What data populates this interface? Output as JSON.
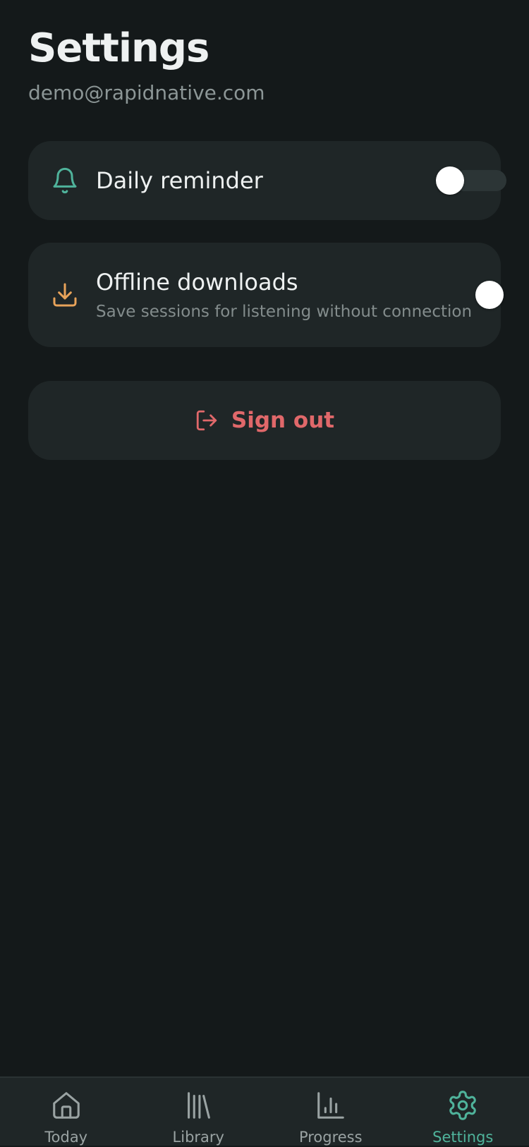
{
  "header": {
    "title": "Settings",
    "email": "demo@rapidnative.com"
  },
  "settings": {
    "daily_reminder": {
      "label": "Daily reminder",
      "icon": "bell-icon",
      "enabled": false
    },
    "offline_downloads": {
      "label": "Offline downloads",
      "description": "Save sessions for listening without connection",
      "icon": "download-icon",
      "enabled": true
    }
  },
  "sign_out": {
    "label": "Sign out",
    "icon": "log-out-icon"
  },
  "tabs": [
    {
      "label": "Today",
      "icon": "home-icon",
      "active": false
    },
    {
      "label": "Library",
      "icon": "library-icon",
      "active": false
    },
    {
      "label": "Progress",
      "icon": "bar-chart-icon",
      "active": false
    },
    {
      "label": "Settings",
      "icon": "gear-icon",
      "active": true
    }
  ],
  "colors": {
    "background": "#14191a",
    "card": "#1f2627",
    "accent_teal": "#4fb39b",
    "accent_orange": "#e8a35a",
    "danger": "#e0686a",
    "tab_inactive": "#9aa3a3"
  }
}
